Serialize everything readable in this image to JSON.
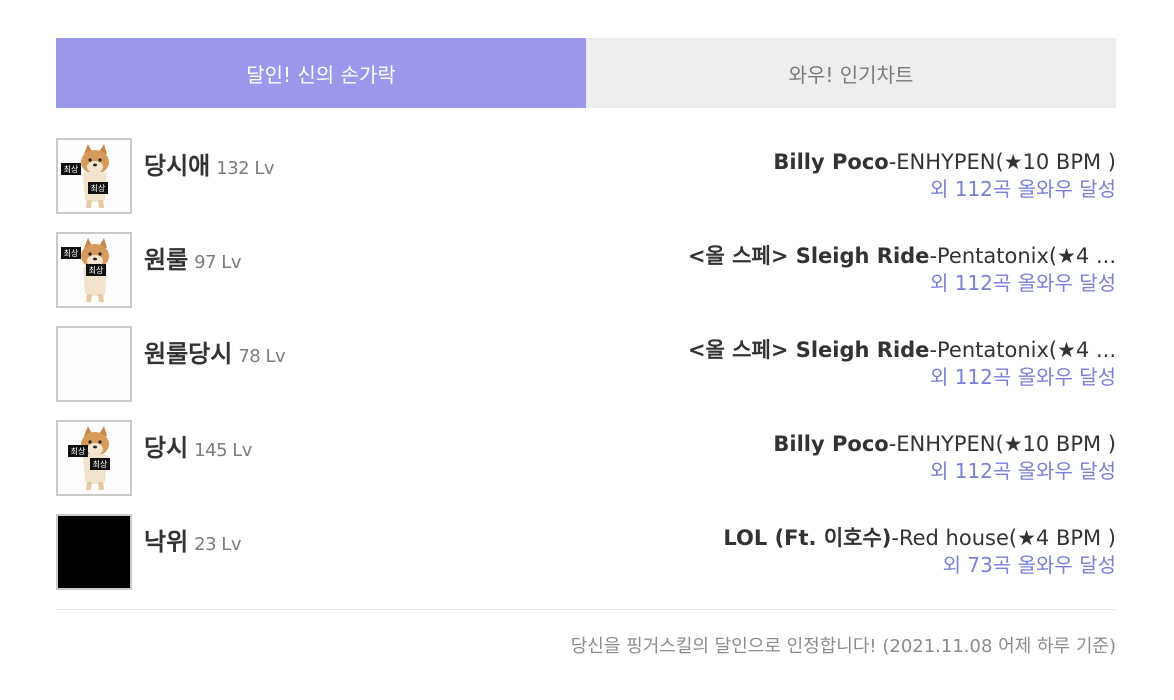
{
  "tabs": [
    {
      "label": "달인! 신의 손가락",
      "active": true
    },
    {
      "label": "와우! 인기차트",
      "active": false
    }
  ],
  "rows": [
    {
      "name": "당시애",
      "level": "132 Lv",
      "song_title": "Billy Poco",
      "song_rest": "-ENHYPEN(★10 BPM )",
      "more": "외 112곡 올와우 달성",
      "avatar": "dog-sticker"
    },
    {
      "name": "원룰",
      "level": "97 Lv",
      "song_title": "<올 스페> Sleigh Ride",
      "song_rest": "-Pentatonix(★4 ...",
      "more": "외 112곡 올와우 달성",
      "avatar": "dog-sticker"
    },
    {
      "name": "원룰당시",
      "level": "78 Lv",
      "song_title": "<올 스페> Sleigh Ride",
      "song_rest": "-Pentatonix(★4 ...",
      "more": "외 112곡 올와우 달성",
      "avatar": "blank"
    },
    {
      "name": "당시",
      "level": "145 Lv",
      "song_title": "Billy Poco",
      "song_rest": "-ENHYPEN(★10 BPM )",
      "more": "외 112곡 올와우 달성",
      "avatar": "dog-sticker"
    },
    {
      "name": "낙위",
      "level": "23 Lv",
      "song_title": "LOL (Ft. 이호수)",
      "song_rest": "-Red house(★4 BPM )",
      "more": "외 73곡 올와우 달성",
      "avatar": "black"
    }
  ],
  "sticker_text": "최상",
  "footer": "당신을 핑거스킬의 달인으로 인정합니다! (2021.11.08 어제 하루 기준)",
  "colors": {
    "accent": "#9b97eb",
    "link": "#7c7fd8",
    "tab_inactive_bg": "#eeeef0"
  }
}
